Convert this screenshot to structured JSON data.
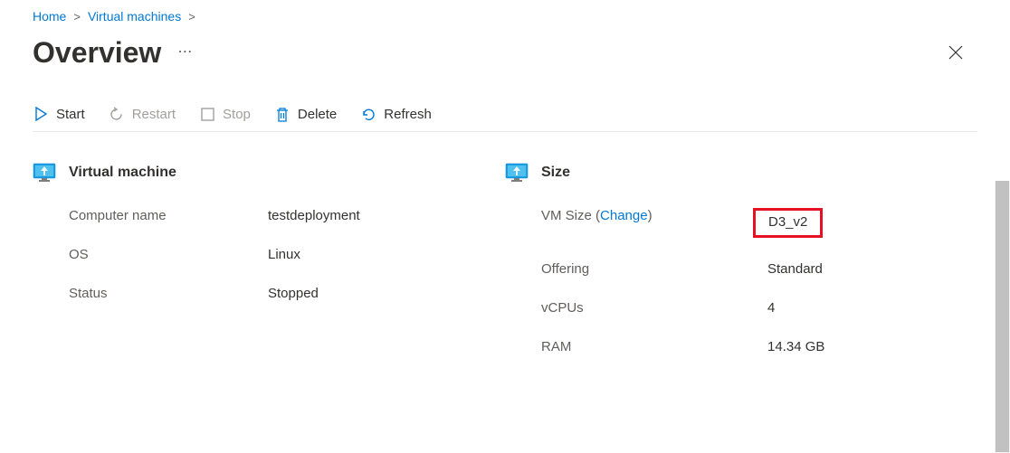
{
  "breadcrumb": {
    "home": "Home",
    "vms": "Virtual machines"
  },
  "page": {
    "title": "Overview",
    "more": "⋯"
  },
  "toolbar": {
    "start": "Start",
    "restart": "Restart",
    "stop": "Stop",
    "delete": "Delete",
    "refresh": "Refresh"
  },
  "sections": {
    "vm": {
      "title": "Virtual machine",
      "rows": {
        "computer_name": {
          "label": "Computer name",
          "value": "testdeployment"
        },
        "os": {
          "label": "OS",
          "value": "Linux"
        },
        "status": {
          "label": "Status",
          "value": "Stopped"
        }
      }
    },
    "size": {
      "title": "Size",
      "rows": {
        "vm_size": {
          "label_prefix": "VM Size (",
          "change": "Change",
          "label_suffix": ")",
          "value": "D3_v2"
        },
        "offering": {
          "label": "Offering",
          "value": "Standard"
        },
        "vcpus": {
          "label": "vCPUs",
          "value": "4"
        },
        "ram": {
          "label": "RAM",
          "value": "14.34 GB"
        }
      }
    }
  },
  "colors": {
    "link": "#0078d4",
    "highlight": "#e81123"
  }
}
